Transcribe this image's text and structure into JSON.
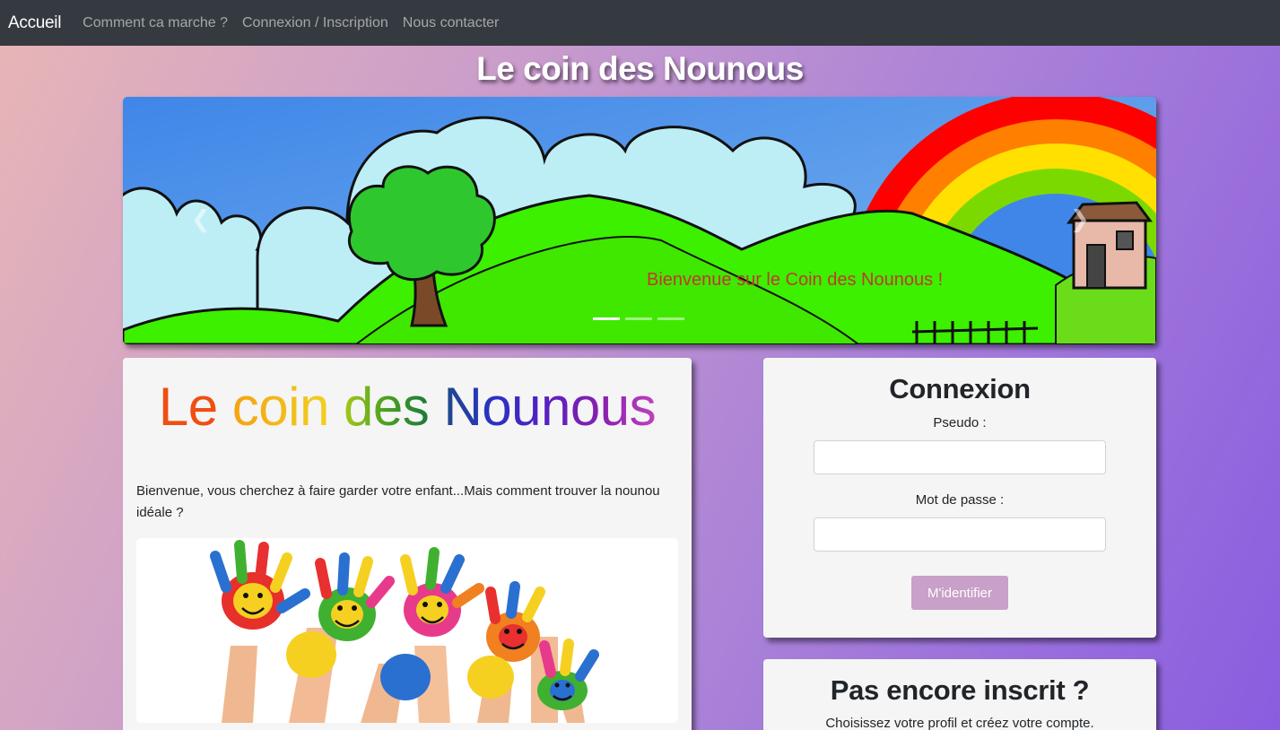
{
  "navbar": {
    "brand": "Accueil",
    "links": [
      "Comment ca marche ?",
      "Connexion / Inscription",
      "Nous contacter"
    ]
  },
  "site_title": "Le coin des Nounous",
  "carousel": {
    "caption": "Bienvenue sur le Coin des Nounous !",
    "prev_icon": "chevron-left-icon",
    "next_icon": "chevron-right-icon",
    "slide_count": 3,
    "active_slide": 1
  },
  "main_card": {
    "title_words": [
      {
        "text": "Le",
        "color": "#f04e12"
      },
      {
        "text": "coin",
        "color": "#f5b312"
      },
      {
        "text": "des",
        "color": "#7cb518"
      },
      {
        "text": "Nounous",
        "color": "#1e3a8a"
      }
    ],
    "intro": "Bienvenue, vous cherchez à faire garder votre enfant...Mais comment trouver la nounou idéale ?"
  },
  "login_card": {
    "title": "Connexion",
    "pseudo_label": "Pseudo :",
    "password_label": "Mot de passe :",
    "pseudo_value": "",
    "password_value": "",
    "submit_label": "M'identifier"
  },
  "register_card": {
    "title": "Pas encore inscrit ?",
    "text": "Choisissez votre profil et créez votre compte."
  },
  "colors": {
    "navbar_bg": "#343a40",
    "button_bg": "#c8a0c8",
    "caption": "#c0392b"
  }
}
